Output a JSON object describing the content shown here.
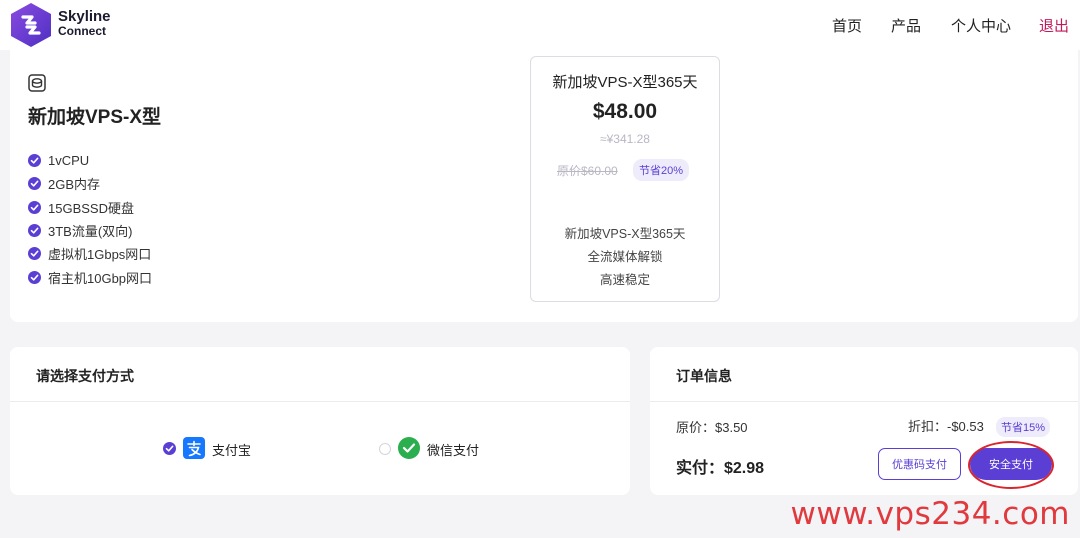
{
  "brand": {
    "line1": "Skyline",
    "line2": "Connect"
  },
  "nav": {
    "home": "首页",
    "products": "产品",
    "account": "个人中心",
    "logout": "退出"
  },
  "product": {
    "name": "新加坡VPS-X型",
    "features": [
      "1vCPU",
      "2GB内存",
      "15GBSSD硬盘",
      "3TB流量(双向)",
      "虚拟机1Gbps网口",
      "宿主机10Gbp网口"
    ]
  },
  "plan": {
    "title": "新加坡VPS-X型365天",
    "price": "$48.00",
    "price_cny": "≈¥341.28",
    "original_price": "原价$60.00",
    "save_badge": "节省20%",
    "desc": [
      "新加坡VPS-X型365天",
      "全流媒体解锁",
      "高速稳定"
    ]
  },
  "payment": {
    "title": "请选择支付方式",
    "methods": [
      {
        "label": "支付宝",
        "selected": true,
        "icon": "alipay-icon"
      },
      {
        "label": "微信支付",
        "selected": false,
        "icon": "wechat-icon"
      }
    ]
  },
  "order": {
    "title": "订单信息",
    "original": "原价：$3.50",
    "discount": "折扣：-$0.53",
    "discount_badge": "节省15%",
    "actual": "实付：$2.98",
    "coupon_button": "优惠码支付",
    "pay_button": "安全支付"
  },
  "colors": {
    "accent": "#5b3fd4",
    "logout": "#c2185b",
    "watermark": "#e0393e"
  },
  "watermark": "www.vps234.com"
}
